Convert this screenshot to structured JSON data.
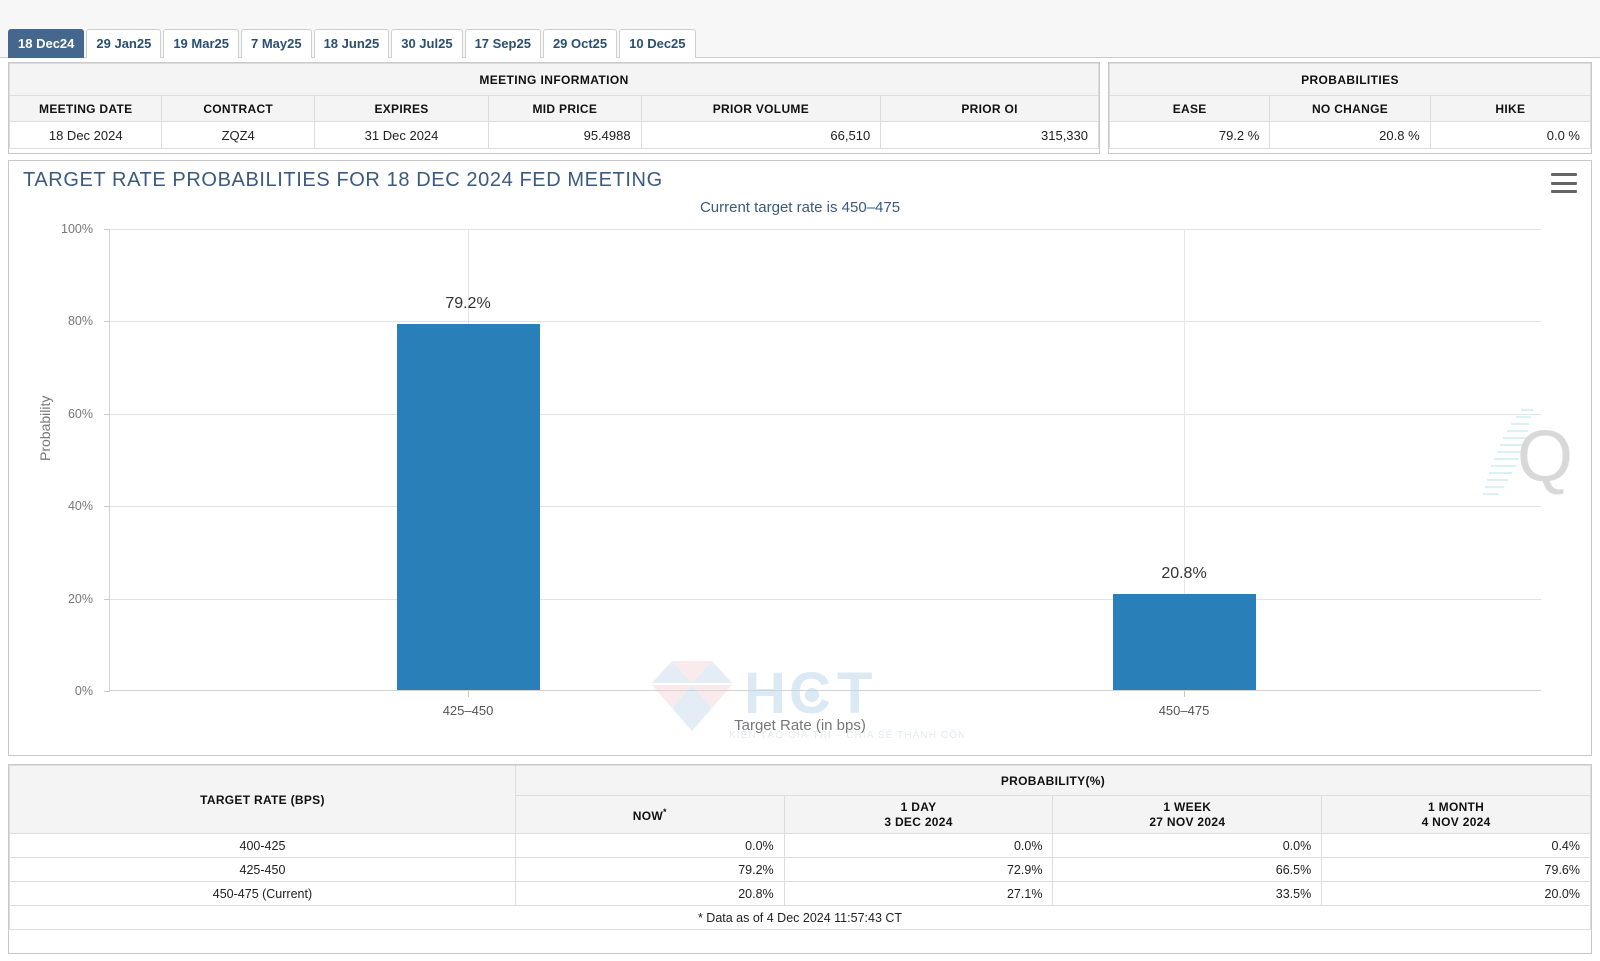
{
  "tabs": [
    {
      "label": "18 Dec24",
      "active": true
    },
    {
      "label": "29 Jan25",
      "active": false
    },
    {
      "label": "19 Mar25",
      "active": false
    },
    {
      "label": "7 May25",
      "active": false
    },
    {
      "label": "18 Jun25",
      "active": false
    },
    {
      "label": "30 Jul25",
      "active": false
    },
    {
      "label": "17 Sep25",
      "active": false
    },
    {
      "label": "29 Oct25",
      "active": false
    },
    {
      "label": "10 Dec25",
      "active": false
    }
  ],
  "meeting_info": {
    "group_title": "MEETING INFORMATION",
    "columns": [
      "MEETING DATE",
      "CONTRACT",
      "EXPIRES",
      "MID PRICE",
      "PRIOR VOLUME",
      "PRIOR OI"
    ],
    "row": [
      "18 Dec 2024",
      "ZQZ4",
      "31 Dec 2024",
      "95.4988",
      "66,510",
      "315,330"
    ]
  },
  "probabilities": {
    "group_title": "PROBABILITIES",
    "columns": [
      "EASE",
      "NO CHANGE",
      "HIKE"
    ],
    "row": [
      "79.2 %",
      "20.8 %",
      "0.0 %"
    ]
  },
  "chart": {
    "title": "TARGET RATE PROBABILITIES FOR 18 DEC 2024 FED MEETING",
    "subtitle": "Current target rate is 450–475",
    "menu_icon": "hamburger-menu-icon",
    "accent_color": "#2980b9",
    "watermark_hct": "HCT",
    "watermark_hct_tagline": "KIẾN TẠO GIÁ TRỊ – CHIA SẺ THÀNH CÔNG",
    "watermark_q": "Q"
  },
  "chart_data": {
    "type": "bar",
    "title": "TARGET RATE PROBABILITIES FOR 18 DEC 2024 FED MEETING",
    "subtitle": "Current target rate is 450–475",
    "categories": [
      "425–450",
      "450–475"
    ],
    "values": [
      79.2,
      20.8
    ],
    "data_labels": [
      "79.2%",
      "20.8%"
    ],
    "xlabel": "Target Rate (in bps)",
    "ylabel": "Probability",
    "ylim": [
      0,
      100
    ],
    "yticks": [
      0,
      20,
      40,
      60,
      80,
      100
    ],
    "ytick_labels": [
      "0%",
      "20%",
      "40%",
      "60%",
      "80%",
      "100%"
    ],
    "grid": true,
    "legend": "none",
    "series_color": "#2980b9"
  },
  "bottom_table": {
    "target_rate_header": "TARGET RATE (BPS)",
    "probability_header": "PROBABILITY(%)",
    "period_columns": [
      {
        "label": "NOW",
        "sub": "",
        "star": true
      },
      {
        "label": "1 DAY",
        "sub": "3 DEC 2024",
        "star": false
      },
      {
        "label": "1 WEEK",
        "sub": "27 NOV 2024",
        "star": false
      },
      {
        "label": "1 MONTH",
        "sub": "4 NOV 2024",
        "star": false
      }
    ],
    "rows": [
      {
        "rate": "400-425",
        "now": "0.0%",
        "day1": "0.0%",
        "week1": "0.0%",
        "month1": "0.4%"
      },
      {
        "rate": "425-450",
        "now": "79.2%",
        "day1": "72.9%",
        "week1": "66.5%",
        "month1": "79.6%"
      },
      {
        "rate": "450-475 (Current)",
        "now": "20.8%",
        "day1": "27.1%",
        "week1": "33.5%",
        "month1": "20.0%"
      }
    ],
    "footnote": "* Data as of 4 Dec 2024 11:57:43 CT"
  }
}
